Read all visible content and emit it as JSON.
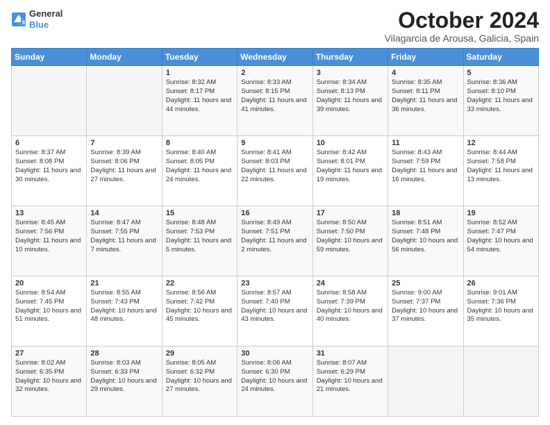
{
  "logo": {
    "line1": "General",
    "line2": "Blue"
  },
  "header": {
    "month": "October 2024",
    "location": "Vilagarcia de Arousa, Galicia, Spain"
  },
  "weekdays": [
    "Sunday",
    "Monday",
    "Tuesday",
    "Wednesday",
    "Thursday",
    "Friday",
    "Saturday"
  ],
  "weeks": [
    [
      {
        "day": "",
        "info": ""
      },
      {
        "day": "",
        "info": ""
      },
      {
        "day": "1",
        "info": "Sunrise: 8:32 AM\nSunset: 8:17 PM\nDaylight: 11 hours and 44 minutes."
      },
      {
        "day": "2",
        "info": "Sunrise: 8:33 AM\nSunset: 8:15 PM\nDaylight: 11 hours and 41 minutes."
      },
      {
        "day": "3",
        "info": "Sunrise: 8:34 AM\nSunset: 8:13 PM\nDaylight: 11 hours and 39 minutes."
      },
      {
        "day": "4",
        "info": "Sunrise: 8:35 AM\nSunset: 8:11 PM\nDaylight: 11 hours and 36 minutes."
      },
      {
        "day": "5",
        "info": "Sunrise: 8:36 AM\nSunset: 8:10 PM\nDaylight: 11 hours and 33 minutes."
      }
    ],
    [
      {
        "day": "6",
        "info": "Sunrise: 8:37 AM\nSunset: 8:08 PM\nDaylight: 11 hours and 30 minutes."
      },
      {
        "day": "7",
        "info": "Sunrise: 8:39 AM\nSunset: 8:06 PM\nDaylight: 11 hours and 27 minutes."
      },
      {
        "day": "8",
        "info": "Sunrise: 8:40 AM\nSunset: 8:05 PM\nDaylight: 11 hours and 24 minutes."
      },
      {
        "day": "9",
        "info": "Sunrise: 8:41 AM\nSunset: 8:03 PM\nDaylight: 11 hours and 22 minutes."
      },
      {
        "day": "10",
        "info": "Sunrise: 8:42 AM\nSunset: 8:01 PM\nDaylight: 11 hours and 19 minutes."
      },
      {
        "day": "11",
        "info": "Sunrise: 8:43 AM\nSunset: 7:59 PM\nDaylight: 11 hours and 16 minutes."
      },
      {
        "day": "12",
        "info": "Sunrise: 8:44 AM\nSunset: 7:58 PM\nDaylight: 11 hours and 13 minutes."
      }
    ],
    [
      {
        "day": "13",
        "info": "Sunrise: 8:45 AM\nSunset: 7:56 PM\nDaylight: 11 hours and 10 minutes."
      },
      {
        "day": "14",
        "info": "Sunrise: 8:47 AM\nSunset: 7:55 PM\nDaylight: 11 hours and 7 minutes."
      },
      {
        "day": "15",
        "info": "Sunrise: 8:48 AM\nSunset: 7:53 PM\nDaylight: 11 hours and 5 minutes."
      },
      {
        "day": "16",
        "info": "Sunrise: 8:49 AM\nSunset: 7:51 PM\nDaylight: 11 hours and 2 minutes."
      },
      {
        "day": "17",
        "info": "Sunrise: 8:50 AM\nSunset: 7:50 PM\nDaylight: 10 hours and 59 minutes."
      },
      {
        "day": "18",
        "info": "Sunrise: 8:51 AM\nSunset: 7:48 PM\nDaylight: 10 hours and 56 minutes."
      },
      {
        "day": "19",
        "info": "Sunrise: 8:52 AM\nSunset: 7:47 PM\nDaylight: 10 hours and 54 minutes."
      }
    ],
    [
      {
        "day": "20",
        "info": "Sunrise: 8:54 AM\nSunset: 7:45 PM\nDaylight: 10 hours and 51 minutes."
      },
      {
        "day": "21",
        "info": "Sunrise: 8:55 AM\nSunset: 7:43 PM\nDaylight: 10 hours and 48 minutes."
      },
      {
        "day": "22",
        "info": "Sunrise: 8:56 AM\nSunset: 7:42 PM\nDaylight: 10 hours and 45 minutes."
      },
      {
        "day": "23",
        "info": "Sunrise: 8:57 AM\nSunset: 7:40 PM\nDaylight: 10 hours and 43 minutes."
      },
      {
        "day": "24",
        "info": "Sunrise: 8:58 AM\nSunset: 7:39 PM\nDaylight: 10 hours and 40 minutes."
      },
      {
        "day": "25",
        "info": "Sunrise: 9:00 AM\nSunset: 7:37 PM\nDaylight: 10 hours and 37 minutes."
      },
      {
        "day": "26",
        "info": "Sunrise: 9:01 AM\nSunset: 7:36 PM\nDaylight: 10 hours and 35 minutes."
      }
    ],
    [
      {
        "day": "27",
        "info": "Sunrise: 8:02 AM\nSunset: 6:35 PM\nDaylight: 10 hours and 32 minutes."
      },
      {
        "day": "28",
        "info": "Sunrise: 8:03 AM\nSunset: 6:33 PM\nDaylight: 10 hours and 29 minutes."
      },
      {
        "day": "29",
        "info": "Sunrise: 8:05 AM\nSunset: 6:32 PM\nDaylight: 10 hours and 27 minutes."
      },
      {
        "day": "30",
        "info": "Sunrise: 8:06 AM\nSunset: 6:30 PM\nDaylight: 10 hours and 24 minutes."
      },
      {
        "day": "31",
        "info": "Sunrise: 8:07 AM\nSunset: 6:29 PM\nDaylight: 10 hours and 21 minutes."
      },
      {
        "day": "",
        "info": ""
      },
      {
        "day": "",
        "info": ""
      }
    ]
  ]
}
